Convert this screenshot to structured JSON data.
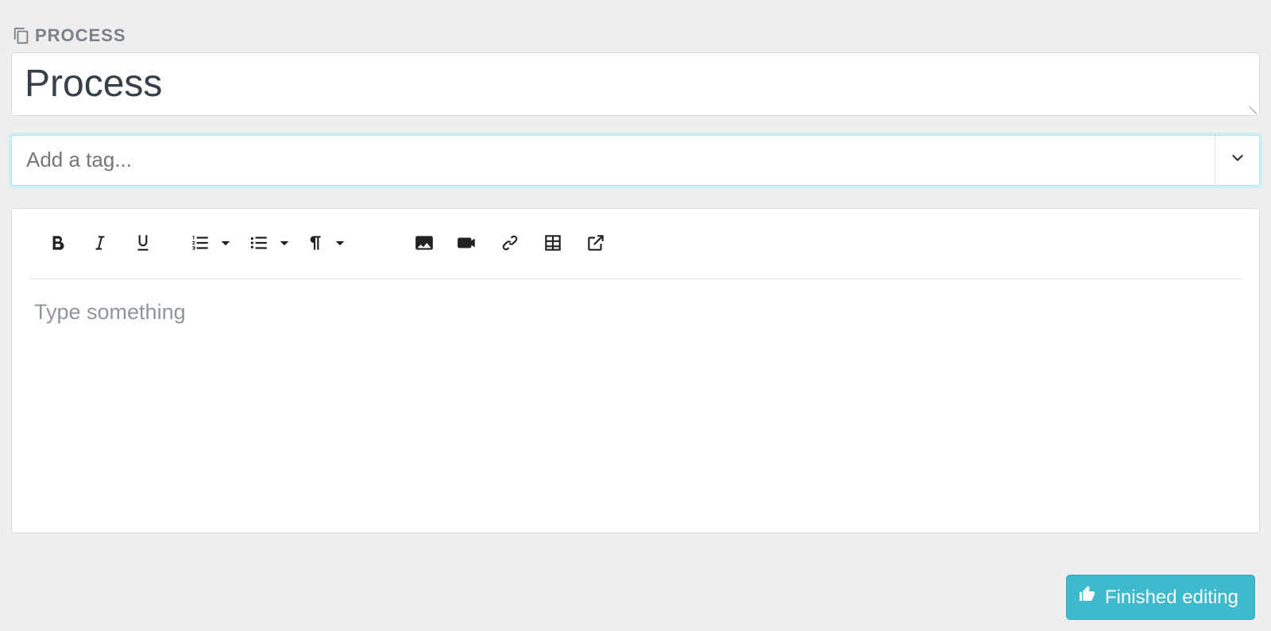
{
  "header": {
    "label": "PROCESS"
  },
  "title": {
    "value": "Process"
  },
  "tags": {
    "placeholder": "Add a tag..."
  },
  "editor": {
    "placeholder": "Type something"
  },
  "actions": {
    "finish": "Finished editing"
  }
}
